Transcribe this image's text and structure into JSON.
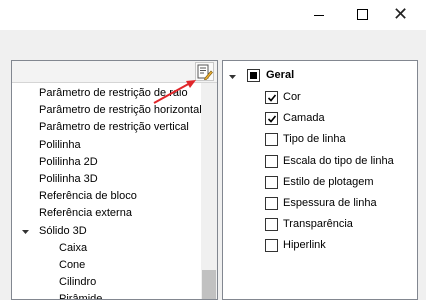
{
  "window": {
    "minimize_glyph": "—",
    "maximize_glyph": "☐",
    "close_glyph": "✕"
  },
  "left_tree": {
    "items": [
      {
        "label": "Parâmetro de restrição de raio",
        "indent": 1,
        "expander": false
      },
      {
        "label": "Parâmetro de restrição horizontal",
        "indent": 1,
        "expander": false
      },
      {
        "label": "Parâmetro de restrição vertical",
        "indent": 1,
        "expander": false
      },
      {
        "label": "Polilinha",
        "indent": 1,
        "expander": false
      },
      {
        "label": "Polilinha 2D",
        "indent": 1,
        "expander": false
      },
      {
        "label": "Polilinha 3D",
        "indent": 1,
        "expander": false
      },
      {
        "label": "Referência de bloco",
        "indent": 1,
        "expander": false
      },
      {
        "label": "Referência externa",
        "indent": 1,
        "expander": false
      },
      {
        "label": "Sólido 3D",
        "indent": 1,
        "expander": true
      },
      {
        "label": "Caixa",
        "indent": 2,
        "expander": false
      },
      {
        "label": "Cone",
        "indent": 2,
        "expander": false
      },
      {
        "label": "Cilindro",
        "indent": 2,
        "expander": false
      },
      {
        "label": "Pirâmide",
        "indent": 2,
        "expander": false
      }
    ],
    "edit_icon": "edit-list-icon",
    "annotation_color": "#e0262a"
  },
  "right_panel": {
    "group": {
      "label": "Geral",
      "state": "partial"
    },
    "options": [
      {
        "label": "Cor",
        "checked": true
      },
      {
        "label": "Camada",
        "checked": true
      },
      {
        "label": "Tipo de linha",
        "checked": false
      },
      {
        "label": "Escala do tipo de linha",
        "checked": false
      },
      {
        "label": "Estilo de plotagem",
        "checked": false
      },
      {
        "label": "Espessura de linha",
        "checked": false
      },
      {
        "label": "Transparência",
        "checked": false
      },
      {
        "label": "Hiperlink",
        "checked": false
      }
    ]
  }
}
